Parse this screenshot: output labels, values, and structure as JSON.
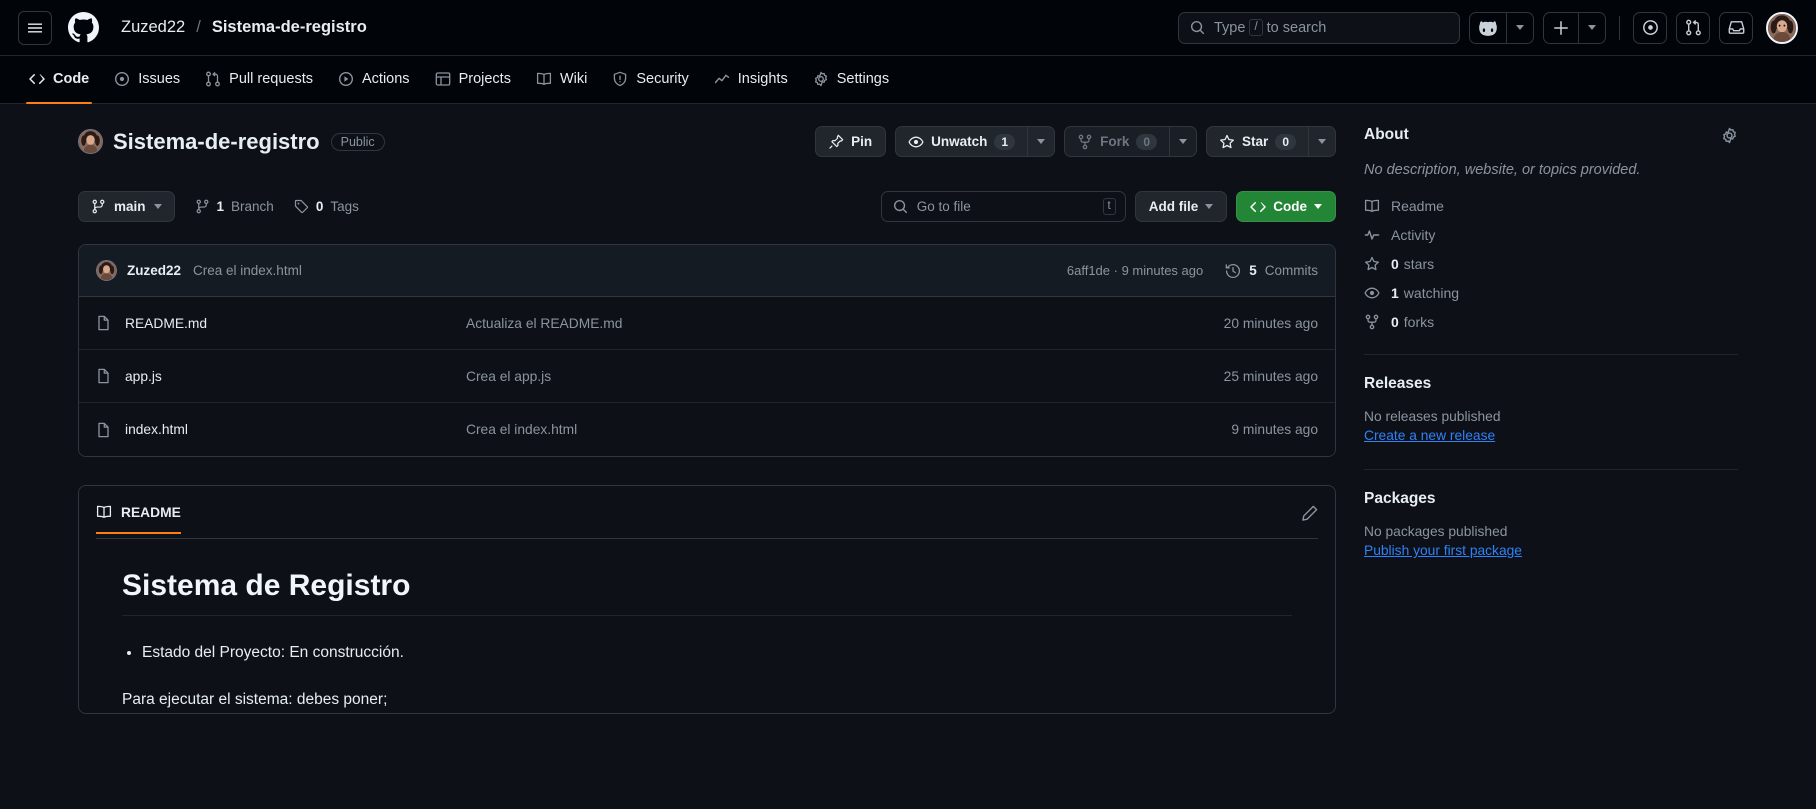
{
  "header": {
    "menu_icon": "hamburger-icon",
    "logo_icon": "github-logo-icon",
    "owner": "Zuzed22",
    "separator": "/",
    "repo": "Sistema-de-registro",
    "search": {
      "placeholder_prefix": "Type",
      "kbd": "/",
      "placeholder_suffix": "to search",
      "icon": "search-icon"
    },
    "copilot_icon": "copilot-icon",
    "plus_icon": "plus-icon",
    "issues_icon": "issue-opened-icon",
    "pull_requests_icon": "git-pull-request-icon",
    "inbox_icon": "inbox-icon",
    "avatar_icon": "user-avatar"
  },
  "nav": {
    "items": [
      {
        "label": "Code",
        "icon": "code-icon",
        "active": true
      },
      {
        "label": "Issues",
        "icon": "issue-opened-icon",
        "active": false
      },
      {
        "label": "Pull requests",
        "icon": "git-pull-request-icon",
        "active": false
      },
      {
        "label": "Actions",
        "icon": "play-icon",
        "active": false
      },
      {
        "label": "Projects",
        "icon": "table-icon",
        "active": false
      },
      {
        "label": "Wiki",
        "icon": "book-icon",
        "active": false
      },
      {
        "label": "Security",
        "icon": "shield-icon",
        "active": false
      },
      {
        "label": "Insights",
        "icon": "graph-icon",
        "active": false
      },
      {
        "label": "Settings",
        "icon": "gear-icon",
        "active": false
      }
    ]
  },
  "repo_header": {
    "name": "Sistema-de-registro",
    "visibility": "Public",
    "pin_label": "Pin",
    "watch_label": "Unwatch",
    "watch_count": "1",
    "fork_label": "Fork",
    "fork_count": "0",
    "star_label": "Star",
    "star_count": "0"
  },
  "toolbar": {
    "branch": "main",
    "branch_count": "1",
    "branch_word": "Branch",
    "tag_count": "0",
    "tag_word": "Tags",
    "go_to_file_placeholder": "Go to file",
    "go_to_file_kbd": "t",
    "add_file_label": "Add file",
    "code_label": "Code"
  },
  "commit_bar": {
    "author": "Zuzed22",
    "message": "Crea el index.html",
    "hash_and_time": "6aff1de · 9 minutes ago",
    "commits_count": "5",
    "commits_label": "Commits"
  },
  "files": [
    {
      "name": "README.md",
      "icon": "file-icon",
      "message": "Actualiza el README.md",
      "time": "20 minutes ago"
    },
    {
      "name": "app.js",
      "icon": "file-icon",
      "message": "Crea el app.js",
      "time": "25 minutes ago"
    },
    {
      "name": "index.html",
      "icon": "file-icon",
      "message": "Crea el index.html",
      "time": "9 minutes ago"
    }
  ],
  "readme": {
    "tab_label": "README",
    "edit_icon": "pencil-icon",
    "heading": "Sistema de Registro",
    "bullet": "Estado del Proyecto: En construcción.",
    "paragraph": "Para ejecutar el sistema: debes poner;"
  },
  "sidebar": {
    "about_title": "About",
    "about_description": "No description, website, or topics provided.",
    "links": [
      {
        "label": "Readme",
        "icon": "book-icon",
        "bold": ""
      },
      {
        "label": "Activity",
        "icon": "pulse-icon",
        "bold": ""
      },
      {
        "label": "stars",
        "icon": "star-icon",
        "bold": "0"
      },
      {
        "label": "watching",
        "icon": "eye-icon",
        "bold": "1"
      },
      {
        "label": "forks",
        "icon": "fork-icon",
        "bold": "0"
      }
    ],
    "releases_title": "Releases",
    "releases_empty": "No releases published",
    "releases_link": "Create a new release",
    "packages_title": "Packages",
    "packages_empty": "No packages published",
    "packages_link": "Publish your first package"
  },
  "colors": {
    "bg": "#0d1117",
    "header_bg": "#010409",
    "border": "#30363d",
    "accent_green": "#238636",
    "accent_orange": "#fd7e14",
    "link_blue": "#2f81f7",
    "muted": "#8b949e"
  }
}
